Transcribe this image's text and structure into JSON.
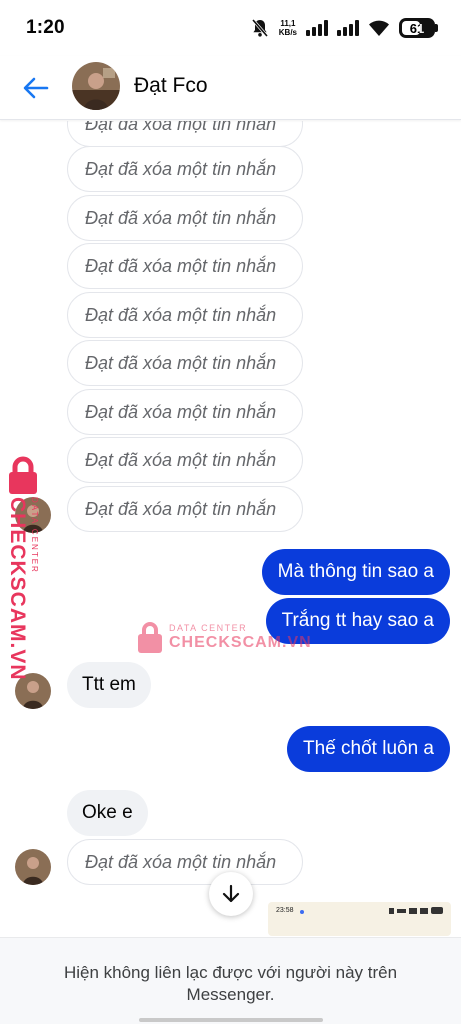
{
  "status_bar": {
    "time": "1:20",
    "network_speed_value": "11,1",
    "network_speed_unit": "KB/s",
    "battery": "61",
    "battery_level": 0.61,
    "icons": [
      "bell-muted-icon",
      "signal-icon",
      "signal-icon",
      "wifi-icon",
      "battery-icon"
    ]
  },
  "header": {
    "contact_name": "Đạt Fco",
    "back_icon": "back-arrow-icon"
  },
  "messages": {
    "deleted_text": "Đạt đã xóa một tin nhắn",
    "sent_1": "Mà thông tin sao a",
    "sent_2": "Trắng tt hay sao a",
    "recv_1": "Ttt em",
    "sent_3": "Thế chốt luôn a",
    "recv_2": "Oke e"
  },
  "watermark": {
    "brand": "CHECKSCAM.VN",
    "sub": "DATA CENTER",
    "color": "#e8365d"
  },
  "thumbnail": {
    "time": "23:58"
  },
  "footer": {
    "notice": "Hiện không liên lạc được với người này trên Messenger."
  },
  "colors": {
    "sent_bubble": "#0a3cdb",
    "received_bubble": "#f0f2f5",
    "accent": "#0a7cff"
  }
}
